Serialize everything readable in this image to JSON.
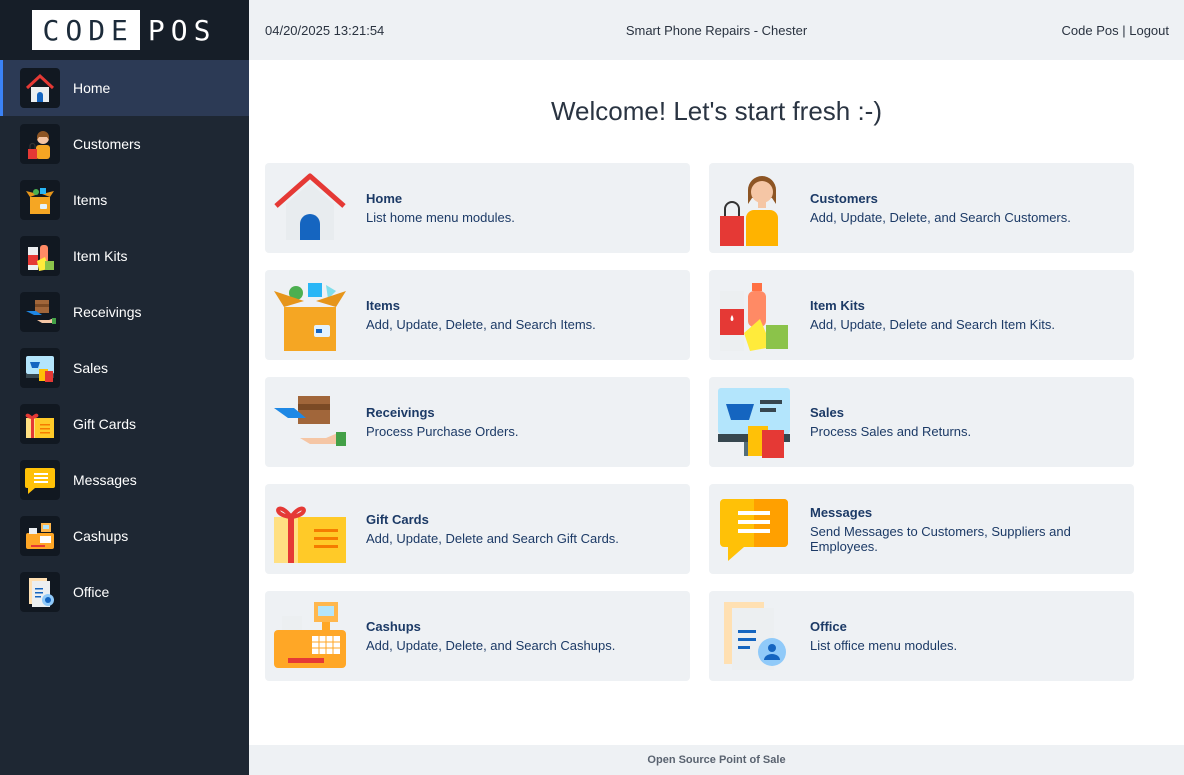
{
  "brand": {
    "logo_left": "CODE",
    "logo_right": "POS"
  },
  "header": {
    "datetime": "04/20/2025 13:21:54",
    "store": "Smart Phone Repairs - Chester",
    "user_link": "Code Pos",
    "separator": "|",
    "logout": "Logout"
  },
  "sidebar": {
    "items": [
      {
        "label": "Home"
      },
      {
        "label": "Customers"
      },
      {
        "label": "Items"
      },
      {
        "label": "Item Kits"
      },
      {
        "label": "Receivings"
      },
      {
        "label": "Sales"
      },
      {
        "label": "Gift Cards"
      },
      {
        "label": "Messages"
      },
      {
        "label": "Cashups"
      },
      {
        "label": "Office"
      }
    ],
    "active_index": 0
  },
  "main": {
    "welcome": "Welcome! Let's start fresh :-)",
    "modules": [
      {
        "title": "Home",
        "desc": "List home menu modules."
      },
      {
        "title": "Customers",
        "desc": "Add, Update, Delete, and Search Customers."
      },
      {
        "title": "Items",
        "desc": "Add, Update, Delete, and Search Items."
      },
      {
        "title": "Item Kits",
        "desc": "Add, Update, Delete and Search Item Kits."
      },
      {
        "title": "Receivings",
        "desc": "Process Purchase Orders."
      },
      {
        "title": "Sales",
        "desc": "Process Sales and Returns."
      },
      {
        "title": "Gift Cards",
        "desc": "Add, Update, Delete and Search Gift Cards."
      },
      {
        "title": "Messages",
        "desc": "Send Messages to Customers, Suppliers and Employees."
      },
      {
        "title": "Cashups",
        "desc": "Add, Update, Delete, and Search Cashups."
      },
      {
        "title": "Office",
        "desc": "List office menu modules."
      }
    ]
  },
  "footer": {
    "text": "Open Source Point of Sale"
  },
  "colors": {
    "sidebar_bg": "#1e2733",
    "active_bg": "#2c3a55",
    "card_bg": "#eef1f4",
    "title_color": "#1c3a66"
  }
}
